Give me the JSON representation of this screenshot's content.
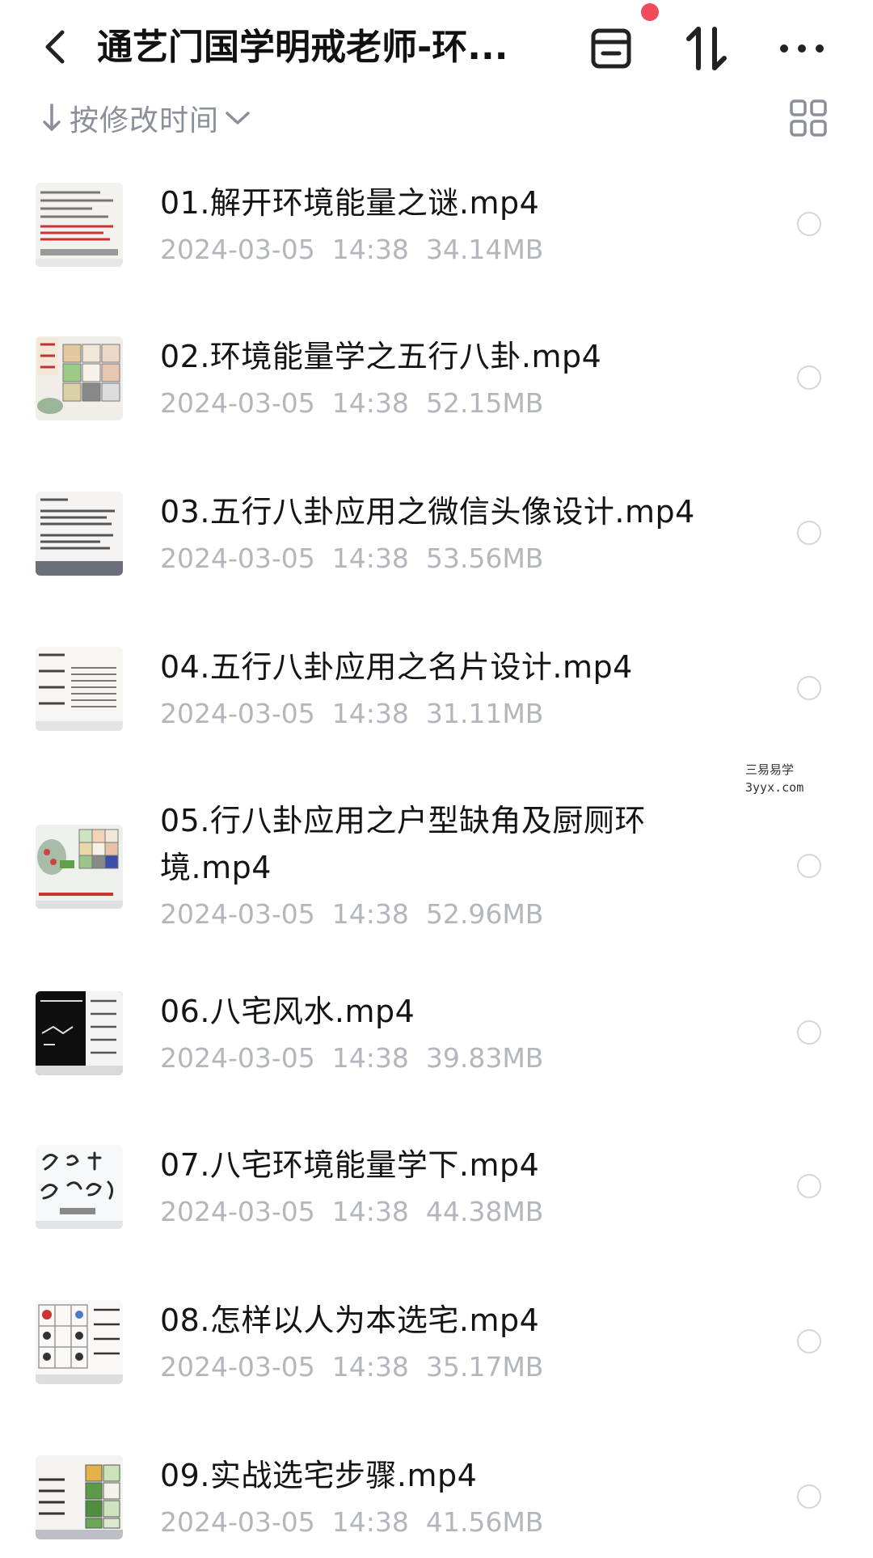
{
  "header": {
    "title": "通艺门国学明戒老师-环...",
    "back_icon": "chevron-left-icon",
    "icons": [
      "archive-box-icon",
      "sort-arrows-icon",
      "more-horizontal-icon"
    ],
    "notification_color": "#f04a5c"
  },
  "sortbar": {
    "label": "按修改时间",
    "view_icon": "grid-view-icon"
  },
  "files": [
    {
      "name": "01.解开环境能量之谜.mp4",
      "date": "2024-03-05",
      "time": "14:38",
      "size": "34.14MB"
    },
    {
      "name": "02.环境能量学之五行八卦.mp4",
      "date": "2024-03-05",
      "time": "14:38",
      "size": "52.15MB"
    },
    {
      "name": "03.五行八卦应用之微信头像设计.mp4",
      "date": "2024-03-05",
      "time": "14:38",
      "size": "53.56MB"
    },
    {
      "name": "04.五行八卦应用之名片设计.mp4",
      "date": "2024-03-05",
      "time": "14:38",
      "size": "31.11MB"
    },
    {
      "name": "05.行八卦应用之户型缺角及厨厕环境.mp4",
      "date": "2024-03-05",
      "time": "14:38",
      "size": "52.96MB"
    },
    {
      "name": "06.八宅风水.mp4",
      "date": "2024-03-05",
      "time": "14:38",
      "size": "39.83MB"
    },
    {
      "name": "07.八宅环境能量学下.mp4",
      "date": "2024-03-05",
      "time": "14:38",
      "size": "44.38MB"
    },
    {
      "name": "08.怎样以人为本选宅.mp4",
      "date": "2024-03-05",
      "time": "14:38",
      "size": "35.17MB"
    },
    {
      "name": "09.实战选宅步骤.mp4",
      "date": "2024-03-05",
      "time": "14:38",
      "size": "41.56MB"
    }
  ],
  "watermark": {
    "line1": "三易易学",
    "line2": "3yyx.com"
  }
}
